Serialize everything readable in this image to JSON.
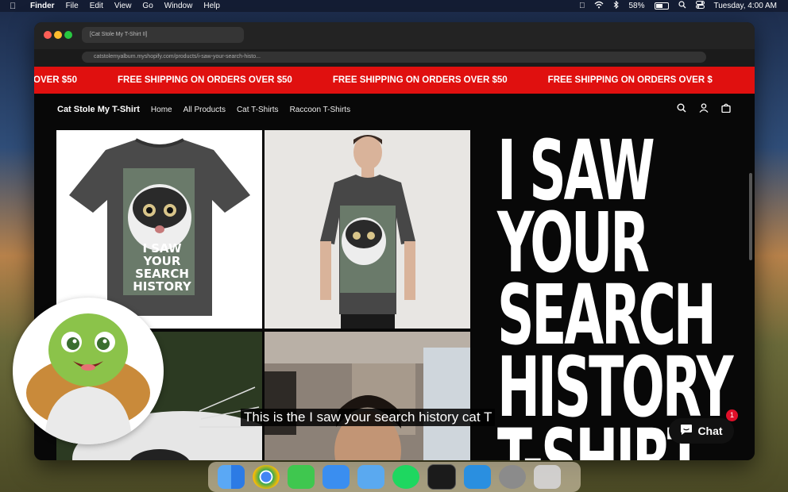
{
  "menubar": {
    "app": "Finder",
    "menus": [
      "File",
      "Edit",
      "View",
      "Go",
      "Window",
      "Help"
    ],
    "battery": "58%",
    "battery_level": 0.58,
    "clock": "Tuesday, 4:00 AM"
  },
  "browser": {
    "tab_title": "[Cat Stole My T-Shirt II]",
    "url": "catstolemyalbum.myshopify.com/products/i-saw-your-search-histo..."
  },
  "banner": {
    "partial_left": "OVER $50",
    "items": [
      "FREE SHIPPING ON ORDERS OVER $50",
      "FREE SHIPPING ON ORDERS OVER $50",
      "FREE SHIPPING ON ORDERS OVER $"
    ]
  },
  "shop_nav": {
    "brand": "Cat Stole My T-Shirt",
    "links": [
      "Home",
      "All Products",
      "Cat T-Shirts",
      "Raccoon T-Shirts"
    ]
  },
  "hero": {
    "lines": [
      "I SAW",
      "YOUR",
      "SEARCH",
      "HISTORY",
      "T-SHIRT"
    ]
  },
  "product_images": {
    "shirt_print_lines": [
      "I SAW",
      "YOUR",
      "SEARCH",
      "HISTORY"
    ]
  },
  "caption": "This is the I saw your search history cat T",
  "chat": {
    "label": "Chat",
    "badge": "1"
  },
  "colors": {
    "banner": "#e0100f",
    "page_bg": "#080808",
    "chat_badge": "#e0102a"
  },
  "dock": {
    "icons": [
      "finder-icon",
      "chrome-icon",
      "messages-icon",
      "safari-icon",
      "mail-icon",
      "spotify-icon",
      "terminal-icon",
      "vscode-icon",
      "settings-icon",
      "trash-icon"
    ]
  }
}
